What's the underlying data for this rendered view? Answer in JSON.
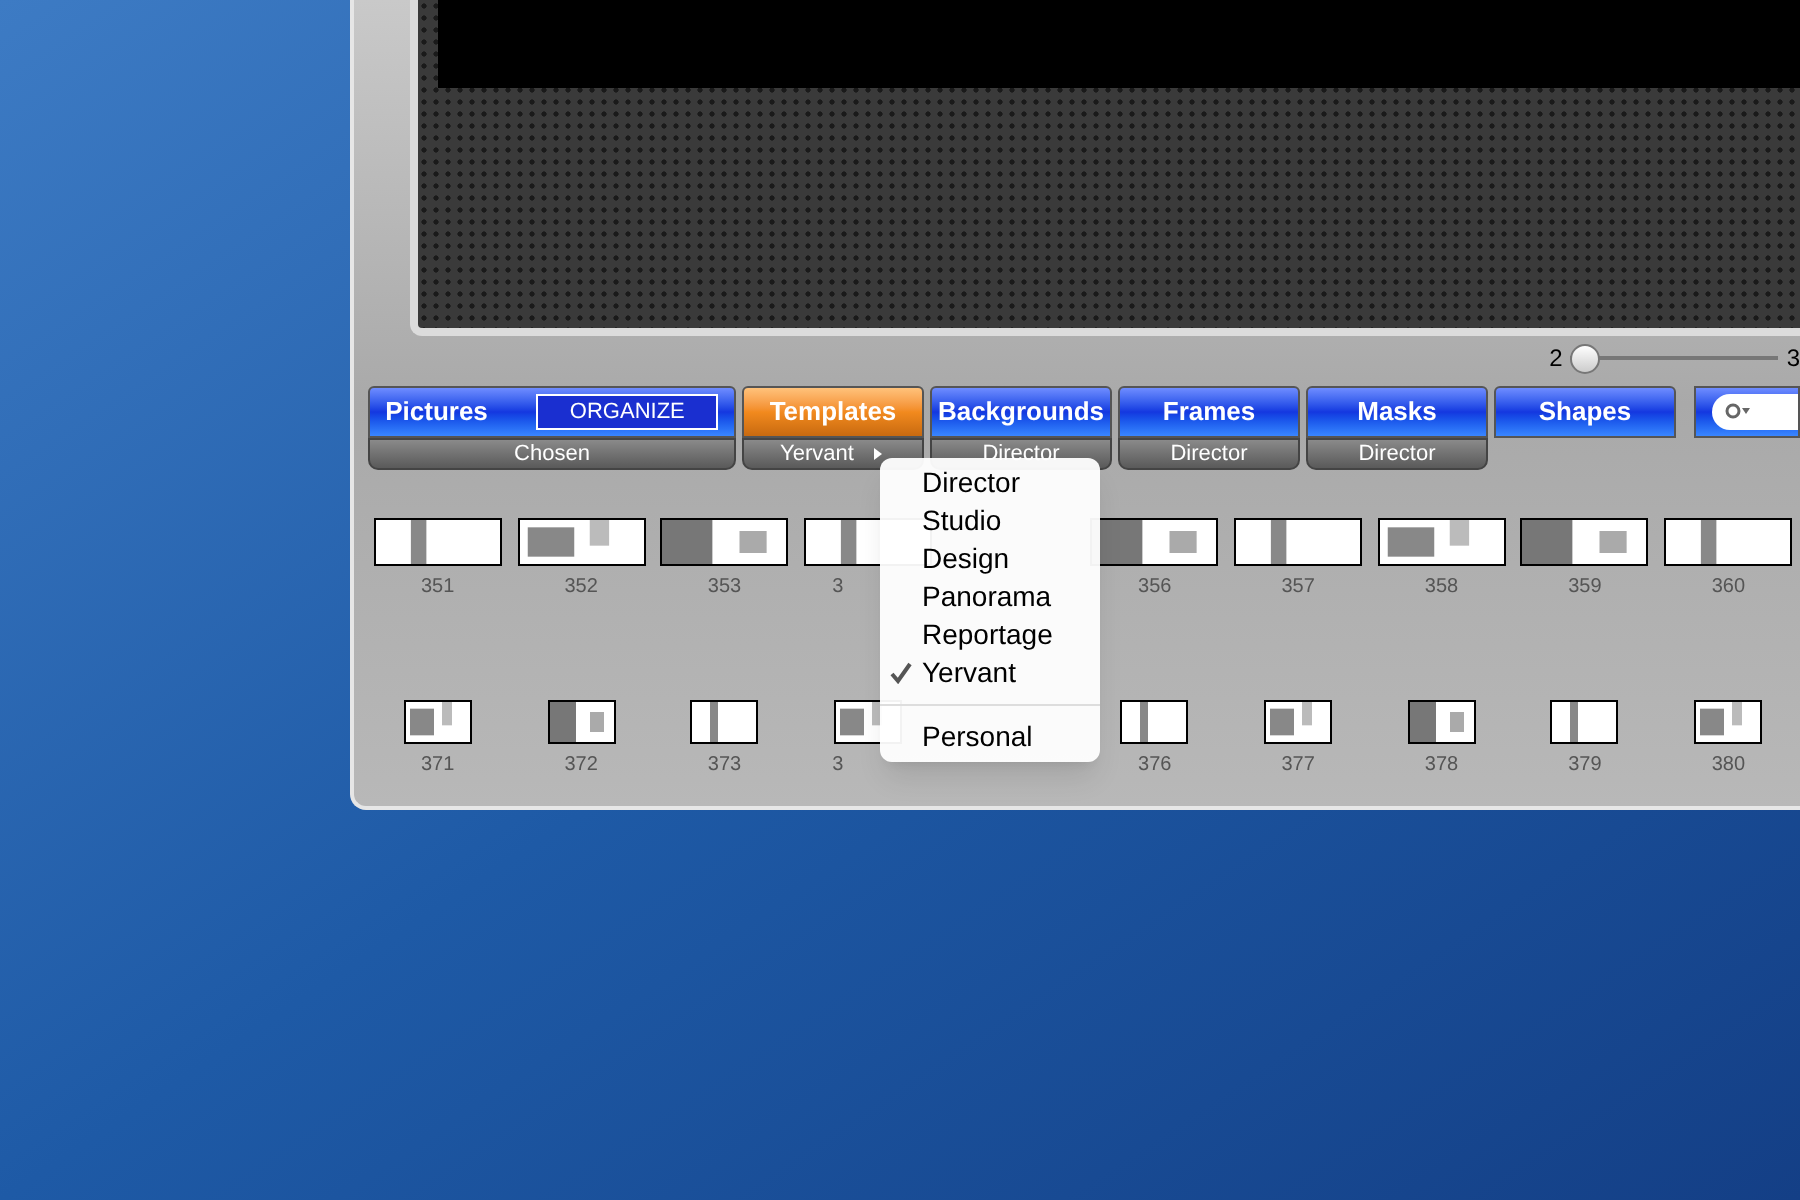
{
  "slider": {
    "min_label": "2",
    "max_label": "3",
    "level": 0.0
  },
  "tabs": [
    {
      "label": "Pictures",
      "button": "ORGANIZE",
      "sub": "Chosen",
      "has_menu": false,
      "selected": false
    },
    {
      "label": "Templates",
      "sub": "Yervant",
      "has_menu": true,
      "selected": true
    },
    {
      "label": "Backgrounds",
      "sub": "Director",
      "has_menu": false,
      "selected": false
    },
    {
      "label": "Frames",
      "sub": "Director",
      "has_menu": false,
      "selected": false
    },
    {
      "label": "Masks",
      "sub": "Director",
      "has_menu": false,
      "selected": false
    },
    {
      "label": "Shapes",
      "selected": false
    }
  ],
  "thumbnails_row_1": [
    {
      "kind": "full",
      "label": "351"
    },
    {
      "kind": "full",
      "label": "352"
    },
    {
      "kind": "full",
      "label": "353"
    },
    {
      "kind": "partial",
      "label": "3"
    },
    {
      "kind": "covered"
    },
    {
      "kind": "full",
      "label": "356"
    },
    {
      "kind": "full",
      "label": "357"
    },
    {
      "kind": "full",
      "label": "358"
    },
    {
      "kind": "full",
      "label": "359"
    },
    {
      "kind": "full",
      "label": "360"
    }
  ],
  "thumbnails_row_2": [
    {
      "kind": "full",
      "label": "371"
    },
    {
      "kind": "full",
      "label": "372"
    },
    {
      "kind": "full",
      "label": "373"
    },
    {
      "kind": "partial",
      "label": "3"
    },
    {
      "kind": "covered"
    },
    {
      "kind": "full",
      "label": "376"
    },
    {
      "kind": "full",
      "label": "377"
    },
    {
      "kind": "full",
      "label": "378"
    },
    {
      "kind": "full",
      "label": "379"
    },
    {
      "kind": "full",
      "label": "380"
    }
  ],
  "menu": {
    "items": [
      {
        "label": "Director",
        "selected": false
      },
      {
        "label": "Studio",
        "selected": false
      },
      {
        "label": "Design",
        "selected": false
      },
      {
        "label": "Panorama",
        "selected": false
      },
      {
        "label": "Reportage",
        "selected": false
      },
      {
        "label": "Yervant",
        "selected": true
      }
    ],
    "extra_items": [
      {
        "label": "Personal",
        "selected": false
      }
    ]
  }
}
